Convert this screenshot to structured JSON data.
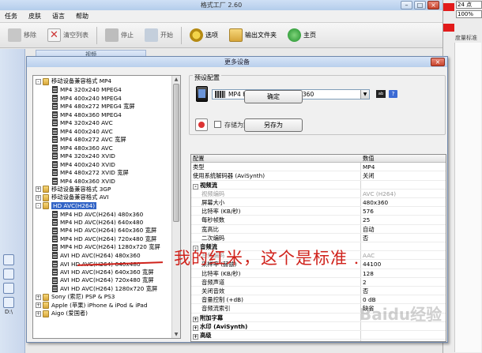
{
  "app": {
    "title": "格式工厂 2.60",
    "menu": [
      "任务",
      "皮肤",
      "语言",
      "帮助"
    ],
    "toolbar": [
      {
        "label": "移除",
        "icon": "remove-icon"
      },
      {
        "label": "清空列表",
        "icon": "clear-list-icon"
      },
      {
        "label": "停止",
        "icon": "stop-icon"
      },
      {
        "label": "开始",
        "icon": "start-icon"
      },
      {
        "label": "选项",
        "icon": "options-icon"
      },
      {
        "label": "输出文件夹",
        "icon": "output-folder-icon"
      },
      {
        "label": "主页",
        "icon": "home-icon"
      }
    ],
    "video_tab": "视频",
    "left_strip_label": "D:\\"
  },
  "side_panel": {
    "field1": "24 点",
    "field2": "100%",
    "label": "度量标准"
  },
  "dialog": {
    "title": "更多设备",
    "preset_group_title": "预设配置",
    "preset_selected": "MP4 HD AVC(H264) 480x360",
    "ok_label": "确定",
    "save_as_label": "另存为",
    "save_checkbox_label": "存储为默认",
    "tree": [
      {
        "level": 0,
        "expander": "-",
        "icon": "folder",
        "label": "移动设备兼容格式 MP4"
      },
      {
        "level": 1,
        "icon": "film",
        "label": "MP4 320x240 MPEG4"
      },
      {
        "level": 1,
        "icon": "film",
        "label": "MP4 400x240 MPEG4"
      },
      {
        "level": 1,
        "icon": "film",
        "label": "MP4 480x272 MPEG4 宽屏"
      },
      {
        "level": 1,
        "icon": "film",
        "label": "MP4 480x360 MPEG4"
      },
      {
        "level": 1,
        "icon": "film",
        "label": "MP4 320x240 AVC"
      },
      {
        "level": 1,
        "icon": "film",
        "label": "MP4 400x240 AVC"
      },
      {
        "level": 1,
        "icon": "film",
        "label": "MP4 480x272 AVC 宽屏"
      },
      {
        "level": 1,
        "icon": "film",
        "label": "MP4 480x360 AVC"
      },
      {
        "level": 1,
        "icon": "film",
        "label": "MP4 320x240 XVID"
      },
      {
        "level": 1,
        "icon": "film",
        "label": "MP4 400x240 XVID"
      },
      {
        "level": 1,
        "icon": "film",
        "label": "MP4 480x272 XVID 宽屏"
      },
      {
        "level": 1,
        "icon": "film",
        "label": "MP4 480x360 XVID"
      },
      {
        "level": 0,
        "expander": "+",
        "icon": "folder",
        "label": "移动设备兼容格式 3GP"
      },
      {
        "level": 0,
        "expander": "+",
        "icon": "folder",
        "label": "移动设备兼容格式 AVI"
      },
      {
        "level": 0,
        "expander": "-",
        "icon": "folder",
        "label": "HD AVC(H264)",
        "selected": true
      },
      {
        "level": 1,
        "icon": "film",
        "label": "MP4 HD AVC(H264) 480x360"
      },
      {
        "level": 1,
        "icon": "film",
        "label": "MP4 HD AVC(H264) 640x480"
      },
      {
        "level": 1,
        "icon": "film",
        "label": "MP4 HD AVC(H264) 640x360 宽屏"
      },
      {
        "level": 1,
        "icon": "film",
        "label": "MP4 HD AVC(H264) 720x480 宽屏"
      },
      {
        "level": 1,
        "icon": "film",
        "label": "MP4 HD AVC(H264) 1280x720 宽屏"
      },
      {
        "level": 1,
        "icon": "film",
        "label": "AVI HD AVC(H264) 480x360"
      },
      {
        "level": 1,
        "icon": "film",
        "label": "AVI HD AVC(H264) 640x480"
      },
      {
        "level": 1,
        "icon": "film",
        "label": "AVI HD AVC(H264) 640x360 宽屏"
      },
      {
        "level": 1,
        "icon": "film",
        "label": "AVI HD AVC(H264) 720x480 宽屏"
      },
      {
        "level": 1,
        "icon": "film",
        "label": "AVI HD AVC(H264) 1280x720 宽屏"
      },
      {
        "level": 0,
        "expander": "+",
        "icon": "folder",
        "label": "Sony (索尼) PSP & PS3"
      },
      {
        "level": 0,
        "expander": "+",
        "icon": "folder",
        "label": "Apple (苹果) iPhone & iPod & iPad"
      },
      {
        "level": 0,
        "expander": "+",
        "icon": "folder",
        "label": "Aigo (爱国者)"
      }
    ],
    "props_header": {
      "key": "配置",
      "value": "数值"
    },
    "props": [
      {
        "kind": "row",
        "key": "类型",
        "value": "MP4"
      },
      {
        "kind": "row",
        "key": "使用系统解码器 (AviSynth)",
        "value": "关闭"
      },
      {
        "kind": "section",
        "expander": "-",
        "key": "视频流",
        "value": ""
      },
      {
        "kind": "child",
        "key": "视频编码",
        "value": "AVC (H264)",
        "disabled": true
      },
      {
        "kind": "child",
        "key": "屏幕大小",
        "value": "480x360"
      },
      {
        "kind": "child",
        "key": "比特率 (KB/秒)",
        "value": "576"
      },
      {
        "kind": "child",
        "key": "每秒帧数",
        "value": "25"
      },
      {
        "kind": "child",
        "key": "宽高比",
        "value": "自动"
      },
      {
        "kind": "child",
        "key": "二次编码",
        "value": "否"
      },
      {
        "kind": "section",
        "expander": "-",
        "key": "音频流",
        "value": ""
      },
      {
        "kind": "child",
        "key": "音频编码",
        "value": "AAC",
        "disabled": true
      },
      {
        "kind": "child",
        "key": "采样率 (赫兹)",
        "value": "44100"
      },
      {
        "kind": "child",
        "key": "比特率 (KB/秒)",
        "value": "128"
      },
      {
        "kind": "child",
        "key": "音频声道",
        "value": "2"
      },
      {
        "kind": "child",
        "key": "关闭音效",
        "value": "否"
      },
      {
        "kind": "child",
        "key": "音量控制 (+dB)",
        "value": "0 dB"
      },
      {
        "kind": "child",
        "key": "音频流索引",
        "value": "缺省"
      },
      {
        "kind": "section",
        "expander": "+",
        "key": "附加字幕",
        "value": ""
      },
      {
        "kind": "section",
        "expander": "+",
        "key": "水印 (AviSynth)",
        "value": ""
      },
      {
        "kind": "section",
        "expander": "+",
        "key": "高级",
        "value": ""
      }
    ]
  },
  "annotation": "我的红米，这个是标准 .",
  "watermark": "Baidu经验",
  "colors": {
    "annotation": "#d0221b",
    "selection": "#3163c6",
    "titlebar": "#b9cfec"
  }
}
